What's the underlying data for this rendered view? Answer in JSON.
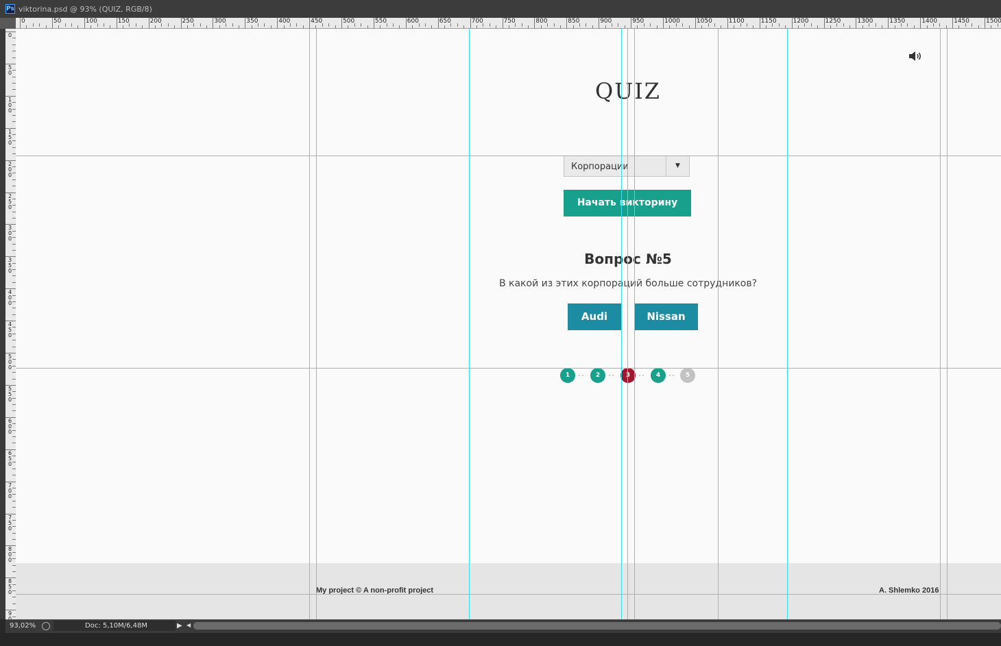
{
  "window": {
    "app_icon": "Ps",
    "title": "viktorina.psd @ 93% (QUIZ, RGB/8)"
  },
  "rulers": {
    "horizontal_labels": [
      "0",
      "50",
      "100",
      "150",
      "200",
      "250",
      "300",
      "350",
      "400",
      "450",
      "500",
      "550",
      "600",
      "650",
      "700",
      "750",
      "800",
      "850",
      "900",
      "950",
      "1000",
      "1050",
      "1100",
      "1150",
      "1200",
      "1250",
      "1300",
      "1350",
      "1400",
      "1450",
      "1500"
    ],
    "vertical_labels": [
      "0",
      "50",
      "100",
      "150",
      "200",
      "250",
      "300",
      "350",
      "400",
      "450",
      "500",
      "550",
      "600",
      "650",
      "700",
      "750",
      "800",
      "850",
      "900"
    ]
  },
  "page": {
    "sound_icon": "speaker-icon",
    "title": "QUIZ",
    "category_select": {
      "value": "Корпорации",
      "arrow": "▼"
    },
    "start_button": "Начать викторину",
    "question": {
      "title": "Вопрос №5",
      "text": "В какой из этих корпораций больше сотрудников?",
      "answers": [
        "Audi",
        "Nissan"
      ]
    },
    "progress": {
      "steps": [
        {
          "label": "1",
          "state": "correct",
          "color": "#19a08c"
        },
        {
          "label": "2",
          "state": "correct",
          "color": "#19a08c"
        },
        {
          "label": "3",
          "state": "wrong",
          "color": "#a0182f"
        },
        {
          "label": "4",
          "state": "correct",
          "color": "#19a08c"
        },
        {
          "label": "5",
          "state": "current",
          "color": "#c2c2c2"
        }
      ]
    },
    "footer": {
      "left": "My project © A non-profit project",
      "right": "A. Shlemko 2016"
    }
  },
  "colors": {
    "accent": "#19a08c",
    "answer_button": "#1c8ca3",
    "wrong": "#a0182f",
    "guides": "#39e0ea"
  },
  "status_bar": {
    "zoom": "93,02%",
    "doc_info": "Doc: 5,10M/6,48M"
  }
}
